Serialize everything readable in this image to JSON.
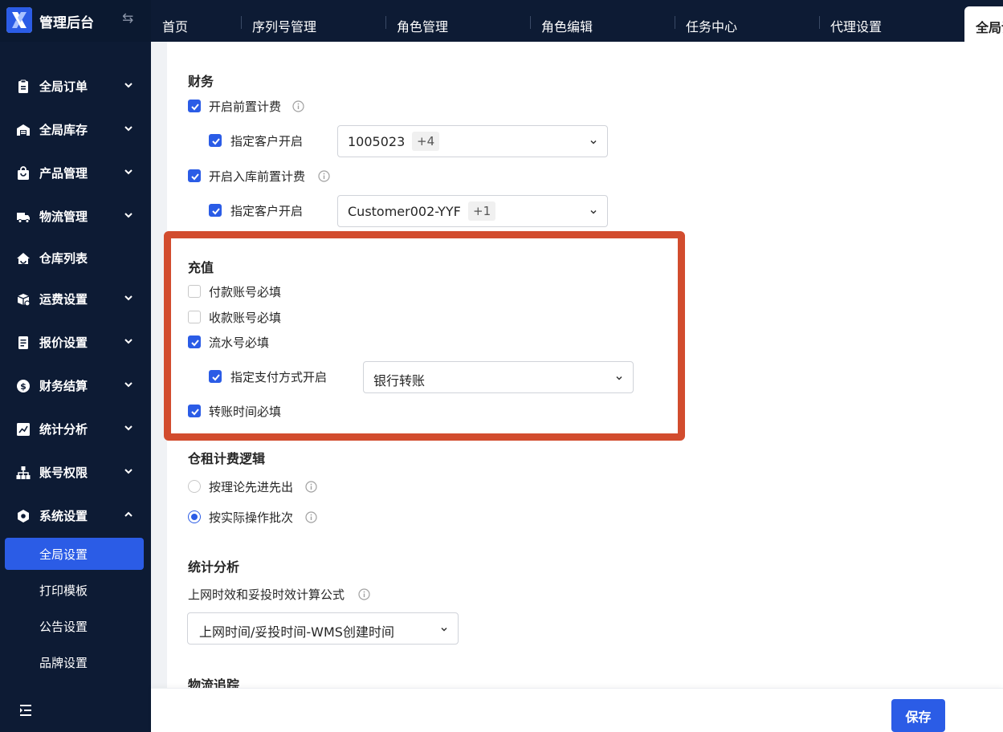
{
  "brand": {
    "title": "管理后台",
    "toggle_icon": "⇆"
  },
  "sidebar": {
    "items": [
      {
        "label": "全局订单",
        "icon": "clipboard-icon",
        "expanded": false
      },
      {
        "label": "全局库存",
        "icon": "warehouse-icon",
        "expanded": false
      },
      {
        "label": "产品管理",
        "icon": "bag-icon",
        "expanded": false
      },
      {
        "label": "物流管理",
        "icon": "truck-icon",
        "expanded": false
      },
      {
        "label": "仓库列表",
        "icon": "home-icon",
        "expanded": null
      },
      {
        "label": "运费设置",
        "icon": "box-icon",
        "expanded": false
      },
      {
        "label": "报价设置",
        "icon": "document-icon",
        "expanded": false
      },
      {
        "label": "财务结算",
        "icon": "dollar-icon",
        "expanded": false
      },
      {
        "label": "统计分析",
        "icon": "chart-icon",
        "expanded": false
      },
      {
        "label": "账号权限",
        "icon": "org-icon",
        "expanded": false
      },
      {
        "label": "系统设置",
        "icon": "hexagon-icon",
        "expanded": true
      }
    ],
    "sub_items": [
      {
        "label": "全局设置",
        "active": true
      },
      {
        "label": "打印模板",
        "active": false
      },
      {
        "label": "公告设置",
        "active": false
      },
      {
        "label": "品牌设置",
        "active": false
      }
    ]
  },
  "tabs": [
    {
      "label": "首页"
    },
    {
      "label": "序列号管理"
    },
    {
      "label": "角色管理"
    },
    {
      "label": "角色编辑"
    },
    {
      "label": "任务中心"
    },
    {
      "label": "代理设置"
    },
    {
      "label": "全局设置",
      "active": true
    }
  ],
  "finance": {
    "title": "财务",
    "prepay": {
      "label": "开启前置计费",
      "checked": true
    },
    "prepay_customer": {
      "label": "指定客户开启",
      "checked": true,
      "value": "1005023",
      "more": "+4"
    },
    "inbound_prepay": {
      "label": "开启入库前置计费",
      "checked": true
    },
    "inbound_customer": {
      "label": "指定客户开启",
      "checked": true,
      "value": "Customer002-YYF",
      "more": "+1"
    }
  },
  "recharge": {
    "title": "充值",
    "payer_account": {
      "label": "付款账号必填",
      "checked": false
    },
    "payee_account": {
      "label": "收款账号必填",
      "checked": false
    },
    "serial_no": {
      "label": "流水号必填",
      "checked": true
    },
    "payment_method": {
      "label": "指定支付方式开启",
      "checked": true,
      "value": "银行转账"
    },
    "transfer_time": {
      "label": "转账时间必填",
      "checked": true
    }
  },
  "storage_fee": {
    "title": "仓租计费逻辑",
    "options": [
      {
        "label": "按理论先进先出",
        "selected": false
      },
      {
        "label": "按实际操作批次",
        "selected": true
      }
    ]
  },
  "stats": {
    "title": "统计分析",
    "formula_label": "上网时效和妥投时效计算公式",
    "formula_value": "上网时间/妥投时间-WMS创建时间"
  },
  "tracking": {
    "title": "物流追踪"
  },
  "footer": {
    "save_label": "保存"
  },
  "colors": {
    "primary": "#2b5ce6",
    "sidebar": "#0d1b34",
    "highlight": "#d24c2e"
  }
}
